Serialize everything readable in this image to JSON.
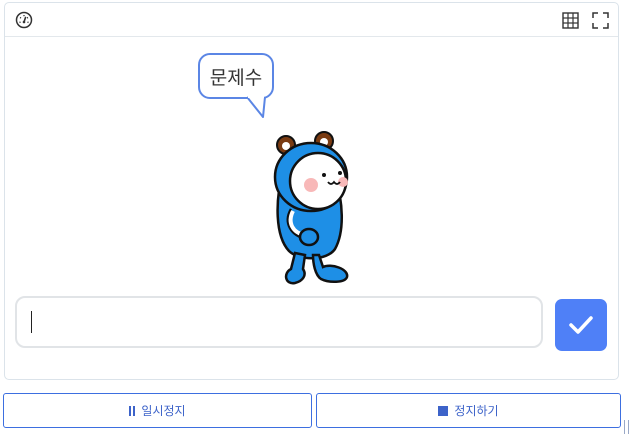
{
  "toolbar": {
    "icons": [
      "speedometer-icon",
      "grid-icon",
      "fullscreen-icon"
    ]
  },
  "stage": {
    "speech_bubble": "문제수"
  },
  "answer": {
    "value": "",
    "submit_icon": "check-icon"
  },
  "controls": {
    "pause_label": "일시정지",
    "stop_label": "정지하기"
  },
  "colors": {
    "accent": "#4f80f7",
    "button_border": "#3d6fe0",
    "bubble_border": "#5b86e5",
    "character_blue": "#1e8fe6"
  }
}
